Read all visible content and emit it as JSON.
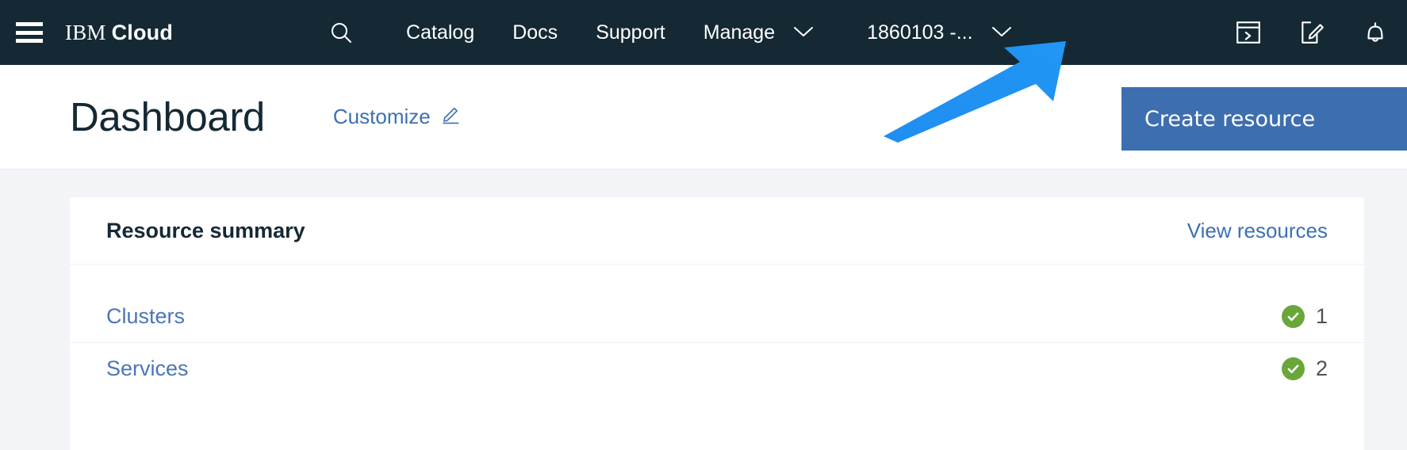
{
  "header": {
    "menu_icon": "hamburger-menu-icon",
    "brand_prefix": "IBM",
    "brand_suffix": "Cloud",
    "search_icon": "search-icon",
    "nav": [
      {
        "label": "Catalog",
        "has_chevron": false
      },
      {
        "label": "Docs",
        "has_chevron": false
      },
      {
        "label": "Support",
        "has_chevron": false
      },
      {
        "label": "Manage",
        "has_chevron": true
      }
    ],
    "account": {
      "label": "1860103 -...",
      "chevron": "chevron-down-icon"
    },
    "icons": [
      {
        "name": "cloud-shell-terminal-icon"
      },
      {
        "name": "edit-document-icon"
      },
      {
        "name": "notifications-bell-icon"
      }
    ],
    "background": "#152934"
  },
  "titlebar": {
    "title": "Dashboard",
    "customize_label": "Customize",
    "customize_icon": "pencil-edit-icon",
    "create_button_label": "Create resource",
    "create_button_color": "#3d6eb0"
  },
  "main": {
    "background": "#f2f4f8",
    "card": {
      "title": "Resource summary",
      "view_link": "View resources",
      "rows": [
        {
          "label": "Clusters",
          "status_icon": "checkmark-filled-icon",
          "status_color": "#6aa739",
          "count": "1"
        },
        {
          "label": "Services",
          "status_icon": "checkmark-filled-icon",
          "status_color": "#6aa739",
          "count": "2"
        }
      ]
    }
  },
  "annotation": {
    "arrow_color": "#1f8ef1",
    "points_to": "cloud-shell-terminal-icon"
  }
}
